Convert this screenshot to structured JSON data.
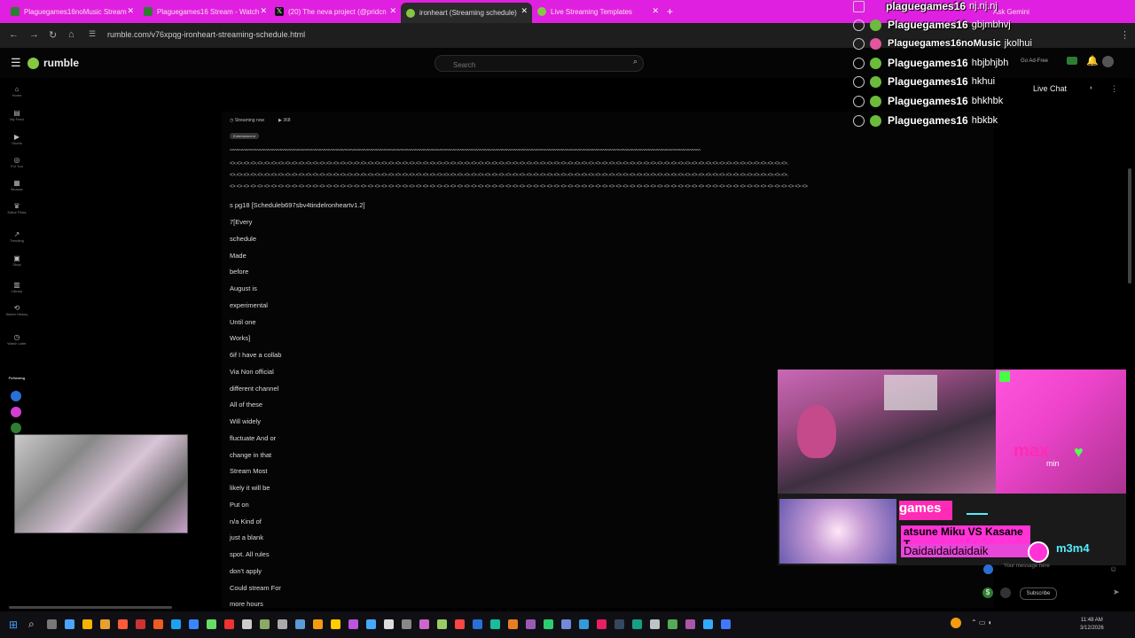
{
  "browser": {
    "tabs": [
      {
        "title": "Plaguegames16noMusic Stream",
        "icon_color": "#2e7d32"
      },
      {
        "title": "Plaguegames16 Stream - Watch",
        "icon_color": "#2e7d32"
      },
      {
        "title": "(20) The neva project (@pridcn",
        "icon_color": "#111111"
      },
      {
        "title": "ironheart (Streaming schedule)",
        "icon_color": "#85c742"
      },
      {
        "title": "Live Streaming Templates",
        "icon_color": "#85c742"
      }
    ],
    "new_tab": "+",
    "url": "rumble.com/v76xpqg-ironheart-streaming-schedule.html",
    "ask_gemini": "Ask Gemini"
  },
  "rumble": {
    "logo_text": "rumble",
    "search_placeholder": "Search",
    "ad_free": "Go Ad-Free",
    "live_chat": "Live Chat",
    "message_placeholder": "Your message here",
    "subscribe": "Subscribe"
  },
  "sidebar": {
    "items": [
      "Home",
      "My Feed",
      "Shorts",
      "For You",
      "Browse",
      "Editor Picks",
      "Trending",
      "Shop",
      "Library",
      "Watch History",
      "Watch Later"
    ],
    "following_label": "Following"
  },
  "video": {
    "status": "Streaming now",
    "views": "368",
    "category": "Entertainment",
    "ascii_rows": [
      "^^^^^^^^^^^^^^^^^^^^^^^^^^^^^^^^^^^^^^^^^^^^^^^^^^^^^^^^^^^^^^^^^^^^^^^^^^^^^^^^^^^^^^^^^^^^^^^^^^^^^^^^^^^^^^^^^^^^^^^^^^^^^^^^^^^^^^^^^^^^^^^^^^^^^^^^^^^^^^^^^^^^^^^^^^^^^^^^^^^^^^^^^^^^^^^^^^^^^^^^^^^^^^^^^^^",
      "<>.<>.<>.<>.<>.<>.<>.<>.<>.<>.<>.<>.<>.<>.<>.<>.<>.<>.<>.<>.<>.<>.<>.<>.<>.<>.<>.<>.<>.<>.<>.<>.<>.<>.<>.<>.<>.<>.<>.<>.<>.<>.<>.<>.<>.<>.<>.<>.<>.<>.<>.<>.<>.<>.<>.<>.<>.<>.<>.<>.<>.<>.<>.<>.<>.<>.<>.<>.<>.<>.<>.<>.<>.<>.<>.<>.<>.<>.<>.<>.<>.",
      "<>.<>.<>.<>.<>.<>.<>.<>.<>.<>.<>.<>.<>.<>.<>.<>.<>.<>.<>.<>.<>.<>.<>.<>.<>.<>.<>.<>.<>.<>.<>.<>.<>.<>.<>.<>.<>.<>.<>.<>.<>.<>.<>.<>.<>.<>.<>.<>.<>.<>.<>.<>.<>.<>.<>.<>.<>.<>.<>.<>.<>.<>.<>.<>.<>.<>.<>.<>.<>.<>.<>.<>.<>.<>.<>.<>.<>.<>.<>.<>.<>.",
      "<> <> <> <> <> <> <> <> <> <> <> <> <> <> <> <> <> <> <> <> <> <> <> <> <> <> <> <> <> <> <> <> <> <> <> <> <> <> <> <> <> <> <> <> <> <> <> <> <> <> <> <> <> <> <> <> <> <> <> <> <> <> <> <> <> <> <> <> <> <> <> <> <> <> <> <> <> <> <> <> <> <> <> <>"
    ],
    "lines": [
      "s pg18 [Scheduleb697sbv4tindelronheartv1.2]",
      "7[Every",
      "schedule",
      "Made",
      "before",
      "August is",
      "experimental",
      "Until one",
      "Works]",
      "6if I have a collab",
      "Via Non official",
      "different channel",
      "All of these",
      "Will widely",
      "fluctuate And or",
      "change in that",
      "Stream Most",
      "likely it will be",
      "Put on",
      "n/a Kind of",
      "just a blank",
      "spot. All rules",
      "don't apply",
      "Could stream For",
      "more hours"
    ]
  },
  "chat": [
    {
      "name": "plaguegames16",
      "message": "nj.nj.nj"
    },
    {
      "name": "Plaguegames16",
      "message": "gbjmbhvj"
    },
    {
      "name": "Plaguegames16noMusic",
      "message": "jkolhui"
    },
    {
      "name": "Plaguegames16",
      "message": "hbjbhjbh"
    },
    {
      "name": "Plaguegames16",
      "message": "hkhui"
    },
    {
      "name": "Plaguegames16",
      "message": "bhkhbk"
    },
    {
      "name": "Plaguegames16",
      "message": "hbkbk"
    }
  ],
  "overlay": {
    "max": "max",
    "min": "min",
    "games": "games",
    "ticker1": "atsune Miku VS Kasane T",
    "ticker2": "Daidaidaidaidaik",
    "m3m4": "m3m4"
  },
  "taskbar": {
    "time": "11:48 AM",
    "date": "3/12/2026"
  }
}
